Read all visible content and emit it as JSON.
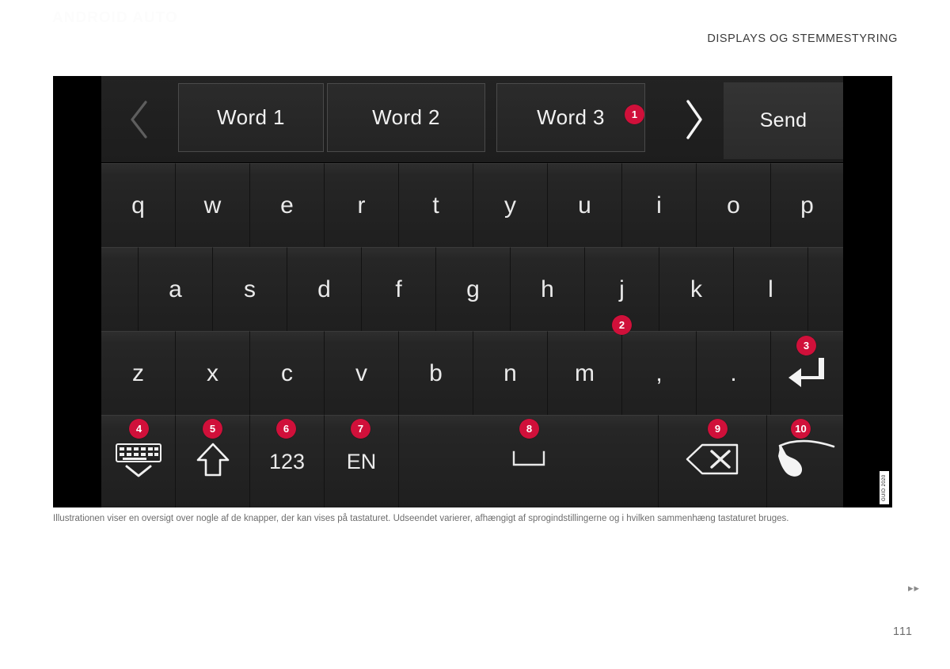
{
  "document": {
    "header": "DISPLAYS OG STEMMESTYRING",
    "watermark": "ANDROID AUTO",
    "page_number": "111",
    "next_marker": "▸▸",
    "image_code": "GUID 2020",
    "caption": "Illustrationen viser en oversigt over nogle af de knapper, der kan vises på tastaturet. Udseendet varierer, afhængigt af sprogindstillingerne og i hvilken sammenhæng tastaturet bruges."
  },
  "colors": {
    "badge_red": "#d0103a",
    "screen_background": "#1b1b1b",
    "frame_black": "#000000",
    "key_text": "#eaeaea"
  },
  "suggestion_bar": {
    "prev_arrow": "‹",
    "next_arrow": "›",
    "words": [
      {
        "label": "Word 1"
      },
      {
        "label": "Word 2"
      },
      {
        "label": "Word 3"
      }
    ],
    "send_label": "Send"
  },
  "keyboard": {
    "row1": [
      "q",
      "w",
      "e",
      "r",
      "t",
      "y",
      "u",
      "i",
      "o",
      "p"
    ],
    "row2": [
      "a",
      "s",
      "d",
      "f",
      "g",
      "h",
      "j",
      "k",
      "l"
    ],
    "row3": [
      "z",
      "x",
      "c",
      "v",
      "b",
      "n",
      "m",
      ",",
      "."
    ],
    "enter_key": {
      "name": "enter-key",
      "icon": "enter-arrow-icon"
    },
    "function_row": [
      {
        "name": "hide-keyboard-key",
        "icon": "hide-keyboard-icon",
        "label": ""
      },
      {
        "name": "shift-key",
        "icon": "shift-arrow-icon",
        "label": ""
      },
      {
        "name": "numbers-key",
        "icon": "",
        "label": "123"
      },
      {
        "name": "language-key",
        "icon": "",
        "label": "EN"
      },
      {
        "name": "space-key",
        "icon": "spacebar-icon",
        "label": ""
      },
      {
        "name": "backspace-key",
        "icon": "backspace-icon",
        "label": ""
      },
      {
        "name": "handwriting-key",
        "icon": "handwriting-hand-icon",
        "label": ""
      }
    ]
  },
  "callouts": [
    {
      "number": "1",
      "target": "word-3-suggestion"
    },
    {
      "number": "2",
      "target": "letter-key-j"
    },
    {
      "number": "3",
      "target": "enter-key"
    },
    {
      "number": "4",
      "target": "hide-keyboard-key"
    },
    {
      "number": "5",
      "target": "shift-key"
    },
    {
      "number": "6",
      "target": "numbers-key"
    },
    {
      "number": "7",
      "target": "language-key"
    },
    {
      "number": "8",
      "target": "space-key"
    },
    {
      "number": "9",
      "target": "backspace-key"
    },
    {
      "number": "10",
      "target": "handwriting-key"
    }
  ]
}
